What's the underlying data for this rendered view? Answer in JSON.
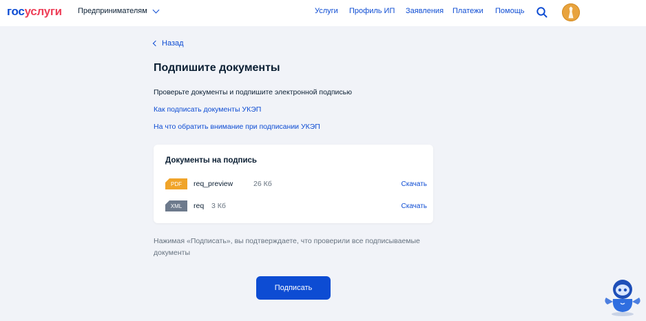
{
  "header": {
    "logo_part1": "гос",
    "logo_part2": "услуги",
    "segment": "Предпринимателям",
    "nav": [
      "Услуги",
      "Профиль ИП",
      "Заявления",
      "Платежи",
      "Помощь"
    ]
  },
  "page": {
    "back": "Назад",
    "title": "Подпишите документы",
    "description": "Проверьте документы и подпишите электронной подписью",
    "links": [
      "Как подписать документы УКЭП",
      "На что обратить внимание при подписании УКЭП"
    ]
  },
  "card": {
    "title": "Документы на подпись",
    "documents": [
      {
        "type": "PDF",
        "name": "req_preview",
        "size": "26 Кб",
        "action": "Скачать",
        "color": "#f0a42a"
      },
      {
        "type": "XML",
        "name": "req",
        "size": "3 Кб",
        "action": "Скачать",
        "color": "#6d7a8c"
      }
    ]
  },
  "note": "Нажимая «Подписать», вы подтверждаете, что проверили все подписываемые документы",
  "sign_button": "Подписать",
  "colors": {
    "accent": "#0d4cd3",
    "brand_red": "#ee3f58",
    "background": "#f1f3f8"
  },
  "icons": [
    "search-icon",
    "avatar",
    "chevron-down-icon",
    "chevron-left-icon",
    "robot-assistant-icon"
  ]
}
